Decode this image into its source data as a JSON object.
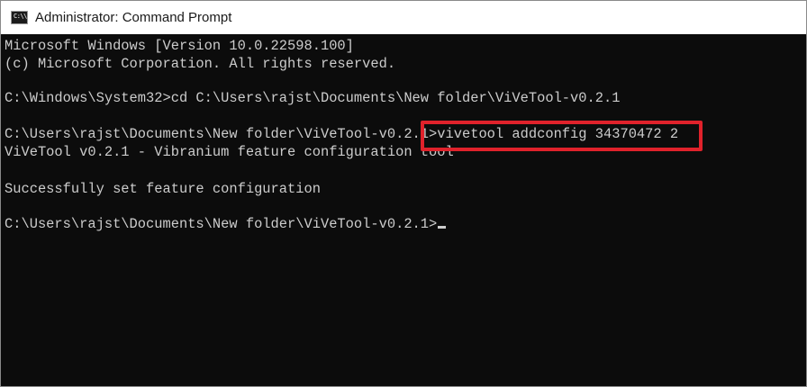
{
  "window": {
    "title": "Administrator: Command Prompt",
    "icon": "cmd-icon",
    "icon_glyph": "C:\\\\"
  },
  "console": {
    "lines": [
      "Microsoft Windows [Version 10.0.22598.100]",
      "(c) Microsoft Corporation. All rights reserved.",
      "",
      "C:\\Windows\\System32>cd C:\\Users\\rajst\\Documents\\New folder\\ViVeTool-v0.2.1",
      "",
      "C:\\Users\\rajst\\Documents\\New folder\\ViVeTool-v0.2.1>vivetool addconfig 34370472 2",
      "ViVeTool v0.2.1 - Vibranium feature configuration tool",
      "",
      "Successfully set feature configuration",
      "",
      "C:\\Users\\rajst\\Documents\\New folder\\ViVeTool-v0.2.1>"
    ]
  },
  "highlight": {
    "color": "#e0222b",
    "text": "vivetool addconfig 34370472 2"
  },
  "colors": {
    "background": "#0c0c0c",
    "foreground": "#cccccc",
    "titlebar": "#ffffff"
  }
}
